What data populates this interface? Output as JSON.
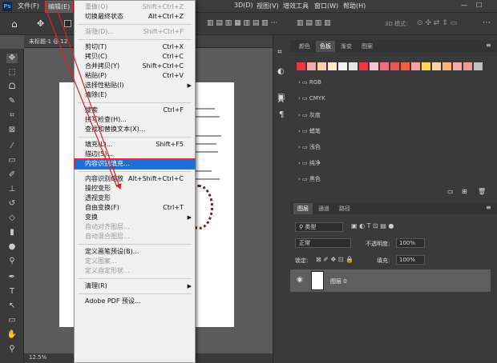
{
  "menubar": {
    "logo": "Ps",
    "items": [
      "文件(F)",
      "编辑(E)",
      "3D(D)",
      "视图(V)",
      "增效工具",
      "窗口(W)",
      "帮助(H)"
    ]
  },
  "options": {
    "mode3d": "3D 模式："
  },
  "document": {
    "tab": "未标题-1 @ 12",
    "zoom": "12.5%"
  },
  "side_strip": {
    "icon_a": "A",
    "icon_p": "¶"
  },
  "swatches_panel": {
    "tabs": [
      "颜色",
      "色板",
      "渐变",
      "图案"
    ],
    "active": "色板",
    "colors": [
      "#e8383d",
      "#f5a9a9",
      "#fbd0b0",
      "#fde9c7",
      "#f3f3f3",
      "#e4e4e4",
      "#ef3742",
      "#f7c5cb",
      "#f07080",
      "#ef5350",
      "#f06040",
      "#fba0a0",
      "#ffd35c",
      "#ffd1a3",
      "#fbb080",
      "#f8a8a8",
      "#ef9a9a",
      "#c0c0c0"
    ],
    "groups": [
      "RGB",
      "CMYK",
      "灰度",
      "蜡笔",
      "浅色",
      "纯净",
      "黑色"
    ]
  },
  "layers_panel": {
    "tabs": [
      "图层",
      "通道",
      "路径"
    ],
    "filter": "类型",
    "blend": "正常",
    "opacity_label": "不透明度:",
    "opacity": "100%",
    "lock_label": "锁定:",
    "fill_label": "填充:",
    "fill": "100%",
    "layer_name": "图层 0"
  },
  "edit_menu": {
    "items": [
      {
        "label": "重做(O)",
        "shortcut": "Shift+Ctrl+Z",
        "disabled": true
      },
      {
        "label": "切换最终状态",
        "shortcut": "Alt+Ctrl+Z"
      },
      {
        "sep": true
      },
      {
        "label": "渐隐(D)...",
        "shortcut": "Shift+Ctrl+F",
        "disabled": true
      },
      {
        "sep": true
      },
      {
        "label": "剪切(T)",
        "shortcut": "Ctrl+X"
      },
      {
        "label": "拷贝(C)",
        "shortcut": "Ctrl+C"
      },
      {
        "label": "合并拷贝(Y)",
        "shortcut": "Shift+Ctrl+C"
      },
      {
        "label": "粘贴(P)",
        "shortcut": "Ctrl+V"
      },
      {
        "label": "选择性粘贴(I)",
        "submenu": true
      },
      {
        "label": "清除(E)"
      },
      {
        "sep": true
      },
      {
        "label": "搜索",
        "shortcut": "Ctrl+F"
      },
      {
        "label": "拼写检查(H)..."
      },
      {
        "label": "查找和替换文本(X)..."
      },
      {
        "sep": true
      },
      {
        "label": "填充(L)...",
        "shortcut": "Shift+F5"
      },
      {
        "label": "描边(S)..."
      },
      {
        "label": "内容识别填充...",
        "highlighted": true
      },
      {
        "sep": true
      },
      {
        "label": "内容识别缩放",
        "shortcut": "Alt+Shift+Ctrl+C"
      },
      {
        "label": "操控变形"
      },
      {
        "label": "透视变形"
      },
      {
        "label": "自由变换(F)",
        "shortcut": "Ctrl+T"
      },
      {
        "label": "变换",
        "submenu": true
      },
      {
        "label": "自动对齐图层...",
        "disabled": true
      },
      {
        "label": "自动混合图层...",
        "disabled": true
      },
      {
        "sep": true
      },
      {
        "label": "定义画笔预设(B)..."
      },
      {
        "label": "定义图案...",
        "disabled": true
      },
      {
        "label": "定义自定形状...",
        "disabled": true
      },
      {
        "sep": true
      },
      {
        "label": "清理(R)",
        "submenu": true
      },
      {
        "sep": true
      },
      {
        "label": "Adobe PDF 预设..."
      }
    ]
  }
}
